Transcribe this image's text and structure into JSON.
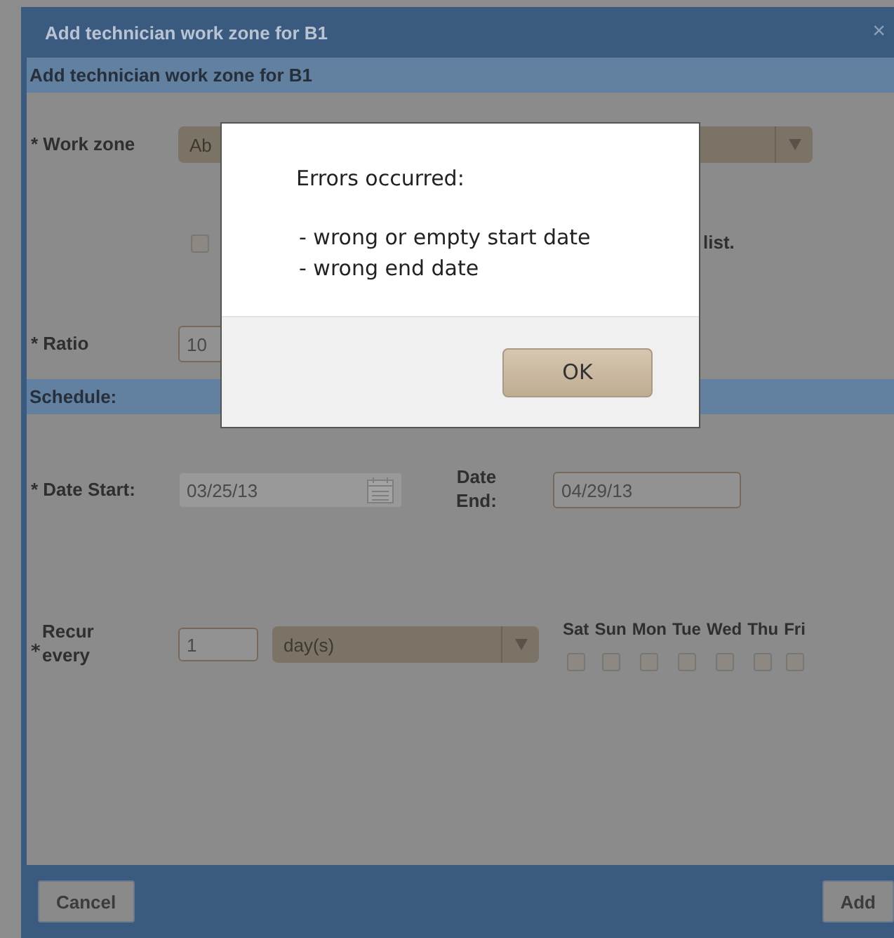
{
  "dialog": {
    "title": "Add technician work zone for B1",
    "close": "×",
    "subtitle": "Add technician work zone for B1"
  },
  "form": {
    "work_zone": {
      "label": "* Work zone",
      "value": "Ab"
    },
    "option": {
      "checked": false,
      "label": "list."
    },
    "ratio": {
      "label": "* Ratio",
      "value": "10"
    }
  },
  "schedule": {
    "title": "Schedule:",
    "date_start": {
      "label": "* Date Start:",
      "value": "03/25/13"
    },
    "date_end": {
      "label": "Date End:",
      "value": "04/29/13"
    },
    "recur": {
      "label": "Recur every",
      "bullet": "*",
      "value": "1",
      "unit": "day(s)"
    },
    "days": [
      {
        "label": "Sat",
        "checked": false
      },
      {
        "label": "Sun",
        "checked": false
      },
      {
        "label": "Mon",
        "checked": false
      },
      {
        "label": "Tue",
        "checked": false
      },
      {
        "label": "Wed",
        "checked": false
      },
      {
        "label": "Thu",
        "checked": false
      },
      {
        "label": "Fri",
        "checked": false
      }
    ]
  },
  "buttons": {
    "cancel": "Cancel",
    "add": "Add"
  },
  "alert": {
    "title": "Errors occurred:",
    "errors": [
      "- wrong or empty start date",
      "- wrong end date"
    ],
    "ok": "OK"
  }
}
